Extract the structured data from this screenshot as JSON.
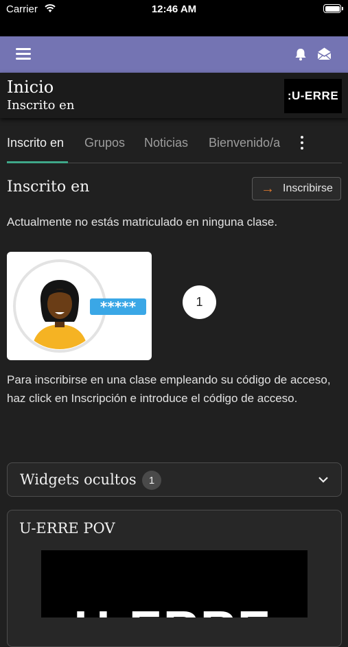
{
  "status_bar": {
    "carrier": "Carrier",
    "time": "12:46 AM"
  },
  "app_bar": {
    "menu_icon": "hamburger-menu-icon",
    "notifications_icon": "bell-icon",
    "messages_icon": "envelope-open-icon",
    "color": "#7474b3"
  },
  "header": {
    "title": "Inicio",
    "subtitle": "Inscrito en",
    "logo_text": ":U-ERRE"
  },
  "tabs": [
    {
      "label": "Inscrito en",
      "active": true
    },
    {
      "label": "Grupos",
      "active": false
    },
    {
      "label": "Noticias",
      "active": false
    },
    {
      "label": "Bienvenido/a",
      "active": false
    }
  ],
  "tabs_more_icon": "vertical-ellipsis-icon",
  "accent": "#3fa889",
  "section": {
    "title": "Inscrito en",
    "enroll_button": "Inscribirse",
    "enroll_icon": "arrow-right-icon",
    "empty_text": "Actualmente no estás matriculado en ninguna clase.",
    "step_number": "1",
    "instructions": "Para inscribirse en una clase empleando su código de acceso, haz click en Inscripción e introduce el código de acceso.",
    "illustration_code": "*****"
  },
  "widgets": {
    "hidden_label": "Widgets ocultos",
    "hidden_count": "1",
    "chevron_icon": "chevron-down-icon",
    "pov_title": "U-ERRE POV",
    "pov_image_text": ":U-ERRE"
  }
}
